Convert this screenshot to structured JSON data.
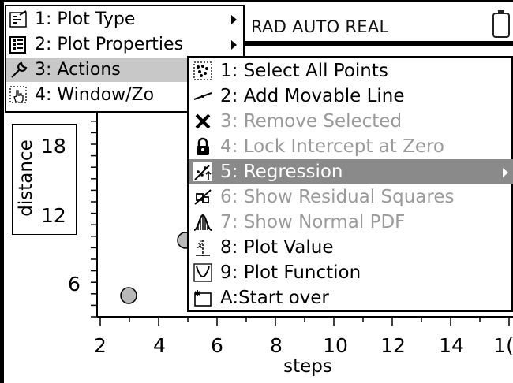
{
  "status_bar": {
    "text": "RAD AUTO REAL",
    "battery_icon": "battery-icon"
  },
  "plot": {
    "ylabel": "distance",
    "xlabel": "steps",
    "yticks": [
      "18",
      "12",
      "6"
    ],
    "xticks": [
      "2",
      "4",
      "6",
      "8",
      "10",
      "12",
      "14",
      "1("
    ],
    "point_color": "#b8b8b8"
  },
  "main_menu": {
    "items": [
      {
        "label": "1: Plot Type",
        "icon": "plot-type-icon",
        "submenu": true
      },
      {
        "label": "2: Plot Properties",
        "icon": "plot-properties-icon",
        "submenu": true
      },
      {
        "label": "3: Actions",
        "icon": "wrench-icon",
        "submenu": false,
        "highlighted": true
      },
      {
        "label": "4: Window/Zo",
        "icon": "hand-zoom-icon",
        "submenu": false
      }
    ]
  },
  "sub_menu": {
    "items": [
      {
        "label": "1: Select All Points",
        "icon": "select-points-icon",
        "disabled": false
      },
      {
        "label": "2: Add Movable Line",
        "icon": "movable-line-icon",
        "disabled": false
      },
      {
        "label": "3: Remove Selected",
        "icon": "remove-x-icon",
        "disabled": true
      },
      {
        "label": "4: Lock Intercept at Zero",
        "icon": "lock-icon",
        "disabled": true
      },
      {
        "label": "5: Regression",
        "icon": "regression-icon",
        "disabled": false,
        "highlighted": true,
        "submenu": true
      },
      {
        "label": "6: Show Residual Squares",
        "icon": "residual-squares-icon",
        "disabled": true
      },
      {
        "label": "7: Show Normal PDF",
        "icon": "normal-pdf-icon",
        "disabled": true
      },
      {
        "label": "8: Plot Value",
        "icon": "plot-value-icon",
        "disabled": false
      },
      {
        "label": "9: Plot Function",
        "icon": "plot-function-icon",
        "disabled": false
      },
      {
        "label": "A:Start over",
        "icon": "start-over-icon",
        "disabled": false
      }
    ]
  }
}
